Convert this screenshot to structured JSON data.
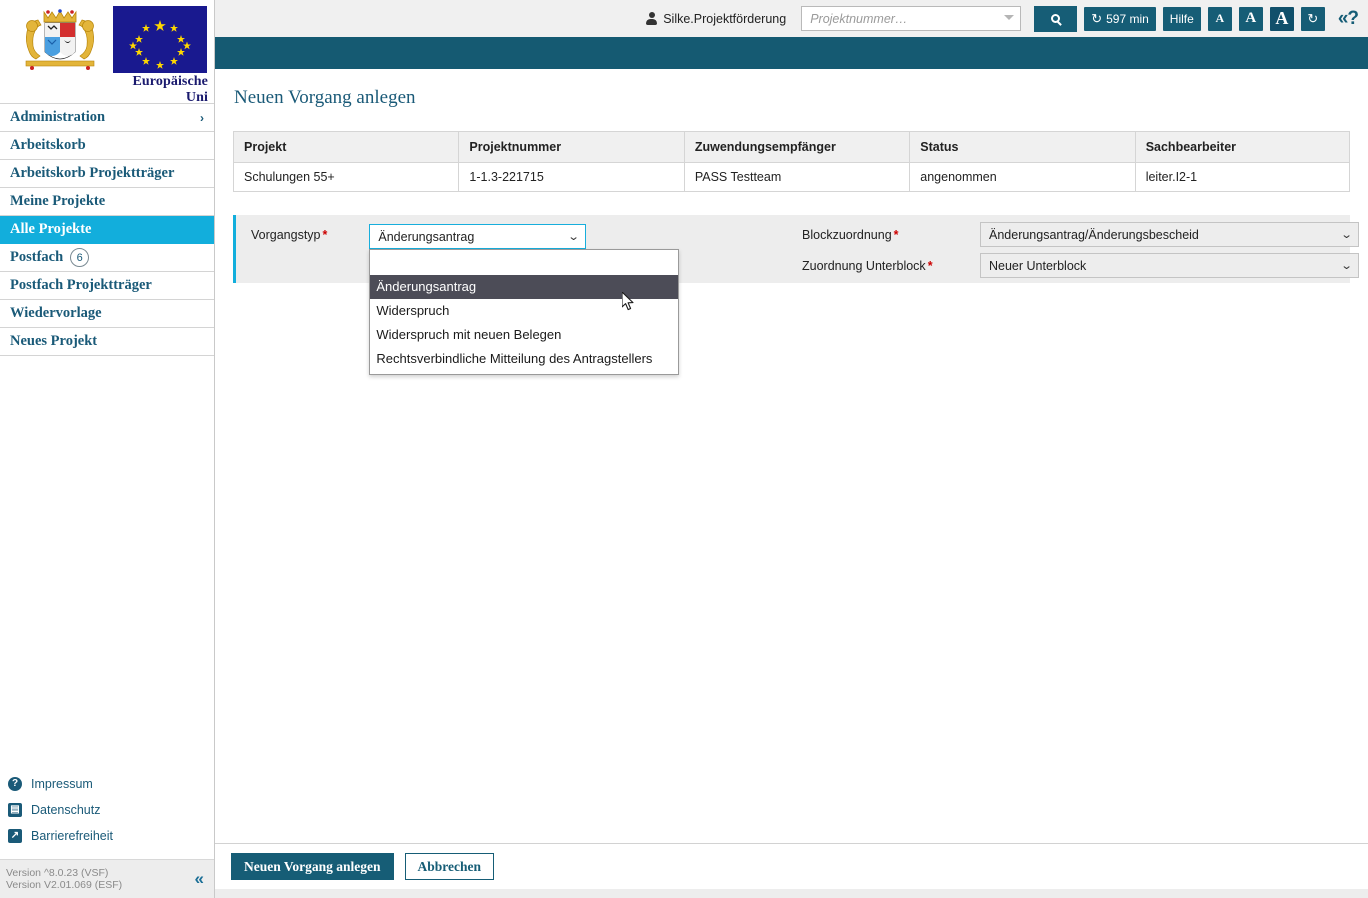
{
  "branding": {
    "coat_of_arms_alt": "Bayern Wappen",
    "eu_flag_alt": "Europaeische Flagge",
    "eu_caption": "Europäische Uni"
  },
  "topbar": {
    "user_icon": "user-icon",
    "user_name": "Silke.Projektförderung",
    "search_placeholder": "Projektnummer…",
    "search_value": "",
    "search_button_icon": "search-icon",
    "session_timer": "597 min",
    "session_timer_icon": "refresh-icon",
    "help_label": "Hilfe",
    "font_small": "A",
    "font_medium": "A",
    "font_large": "A",
    "reload_icon": "refresh-icon",
    "help_toggle": "«?"
  },
  "sidebar": {
    "items": [
      {
        "label": "Administration",
        "badge": null,
        "chevron": "›",
        "active": false
      },
      {
        "label": "Arbeitskorb",
        "badge": null,
        "chevron": "",
        "active": false
      },
      {
        "label": "Arbeitskorb Projektträger",
        "badge": null,
        "chevron": "",
        "active": false
      },
      {
        "label": "Meine Projekte",
        "badge": null,
        "chevron": "",
        "active": false
      },
      {
        "label": "Alle Projekte",
        "badge": null,
        "chevron": "",
        "active": true
      },
      {
        "label": "Postfach",
        "badge": "6",
        "chevron": "",
        "active": false
      },
      {
        "label": "Postfach Projektträger",
        "badge": null,
        "chevron": "",
        "active": false
      },
      {
        "label": "Wiedervorlage",
        "badge": null,
        "chevron": "",
        "active": false
      },
      {
        "label": "Neues Projekt",
        "badge": null,
        "chevron": "",
        "active": false
      }
    ],
    "footer_links": [
      {
        "label": "Impressum",
        "icon": "question-mark-icon"
      },
      {
        "label": "Datenschutz",
        "icon": "document-icon"
      },
      {
        "label": "Barrierefreiheit",
        "icon": "accessibility-icon"
      }
    ],
    "version_line1": "Version ^8.0.23 (VSF)",
    "version_line2": "Version V2.01.069 (ESF)",
    "collapse_icon": "«"
  },
  "main": {
    "page_title": "Neuen Vorgang anlegen",
    "table": {
      "columns": [
        "Projekt",
        "Projektnummer",
        "Zuwendungsempfänger",
        "Status",
        "Sachbearbeiter"
      ],
      "rows": [
        [
          "Schulungen 55+",
          "1-1.3-221715",
          "PASS Testteam",
          "angenommen",
          "leiter.I2-1"
        ]
      ]
    },
    "form": {
      "vorgangstyp": {
        "label": "Vorgangstyp",
        "required_marker": "*",
        "value": "Änderungsantrag",
        "caret_icon": "chevron-down-icon",
        "open": true,
        "options": [
          "",
          "Änderungsantrag",
          "Widerspruch",
          "Widerspruch mit neuen Belegen",
          "Rechtsverbindliche Mitteilung des Antragstellers"
        ],
        "selected_index": 1
      },
      "blockzuordnung": {
        "label": "Blockzuordnung",
        "required_marker": "*",
        "value": "Änderungsantrag/Änderungsbescheid",
        "caret_icon": "chevron-down-icon"
      },
      "zuordnung_unterblock": {
        "label": "Zuordnung Unterblock",
        "required_marker": "*",
        "value": "Neuer Unterblock",
        "caret_icon": "chevron-down-icon"
      }
    },
    "actions": {
      "primary": "Neuen Vorgang anlegen",
      "secondary": "Abbrechen"
    }
  },
  "colors": {
    "teal": "#155A72",
    "cyan": "#12AEDC",
    "header_grey": "#f0f0f0",
    "panel_grey": "#ededed",
    "dropdown_highlight": "#4c4c57",
    "required_red": "#cc0000"
  }
}
